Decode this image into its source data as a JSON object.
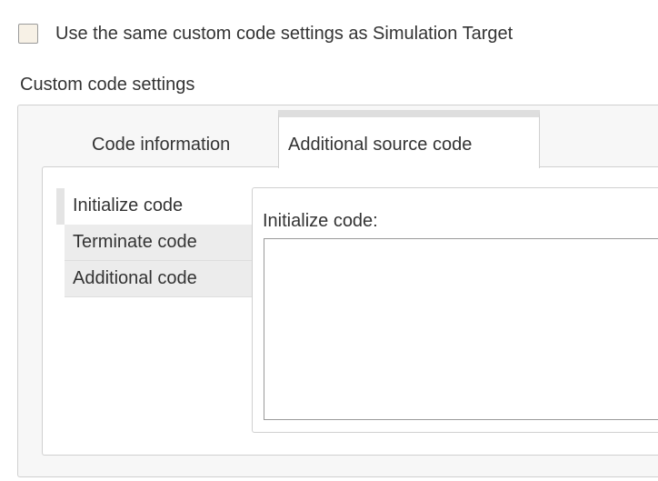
{
  "checkbox": {
    "label": "Use the same custom code settings as Simulation Target",
    "checked": false
  },
  "section": {
    "label": "Custom code settings"
  },
  "tabs": [
    {
      "label": "Code information",
      "active": false
    },
    {
      "label": "Additional source code",
      "active": true
    }
  ],
  "side_items": [
    {
      "label": "Initialize code",
      "active": true
    },
    {
      "label": "Terminate code",
      "active": false
    },
    {
      "label": "Additional code",
      "active": false
    }
  ],
  "content": {
    "field_label": "Initialize code:",
    "value": ""
  },
  "colors": {
    "checkbox_fill": "#f7f1e6",
    "panel_bg": "#f7f7f7",
    "inactive_item_bg": "#ececec",
    "active_tab_top": "#dedede",
    "border": "#d0d0d0",
    "text": "#333333"
  }
}
